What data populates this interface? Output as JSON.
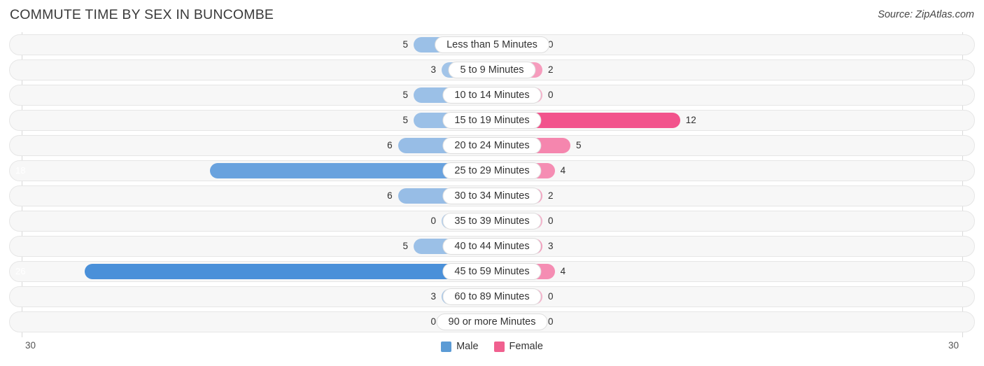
{
  "header": {
    "title": "COMMUTE TIME BY SEX IN BUNCOMBE",
    "source": "Source: ZipAtlas.com"
  },
  "legend": {
    "male_label": "Male",
    "female_label": "Female",
    "male_color": "#5b9bd5",
    "female_color": "#f0608f"
  },
  "axis": {
    "left_tick": "30",
    "right_tick": "30",
    "max": 30
  },
  "chart_data": {
    "type": "bar",
    "title": "COMMUTE TIME BY SEX IN BUNCOMBE",
    "subtitle": "Source: ZipAtlas.com",
    "orientation": "horizontal-diverging",
    "xlabel": "",
    "ylabel": "",
    "xlim": [
      30,
      30
    ],
    "grid": false,
    "legend_position": "bottom-center",
    "categories": [
      "Less than 5 Minutes",
      "5 to 9 Minutes",
      "10 to 14 Minutes",
      "15 to 19 Minutes",
      "20 to 24 Minutes",
      "25 to 29 Minutes",
      "30 to 34 Minutes",
      "35 to 39 Minutes",
      "40 to 44 Minutes",
      "45 to 59 Minutes",
      "60 to 89 Minutes",
      "90 or more Minutes"
    ],
    "series": [
      {
        "name": "Male",
        "values": [
          5,
          3,
          5,
          5,
          6,
          18,
          6,
          0,
          5,
          26,
          3,
          0
        ]
      },
      {
        "name": "Female",
        "values": [
          0,
          2,
          0,
          12,
          5,
          4,
          2,
          0,
          3,
          4,
          0,
          0
        ]
      }
    ]
  },
  "rows": [
    {
      "label": "Less than 5 Minutes",
      "male": "5",
      "female": "0"
    },
    {
      "label": "5 to 9 Minutes",
      "male": "3",
      "female": "2"
    },
    {
      "label": "10 to 14 Minutes",
      "male": "5",
      "female": "0"
    },
    {
      "label": "15 to 19 Minutes",
      "male": "5",
      "female": "12"
    },
    {
      "label": "20 to 24 Minutes",
      "male": "6",
      "female": "5"
    },
    {
      "label": "25 to 29 Minutes",
      "male": "18",
      "female": "4"
    },
    {
      "label": "30 to 34 Minutes",
      "male": "6",
      "female": "2"
    },
    {
      "label": "35 to 39 Minutes",
      "male": "0",
      "female": "0"
    },
    {
      "label": "40 to 44 Minutes",
      "male": "5",
      "female": "3"
    },
    {
      "label": "45 to 59 Minutes",
      "male": "26",
      "female": "4"
    },
    {
      "label": "60 to 89 Minutes",
      "male": "3",
      "female": "0"
    },
    {
      "label": "90 or more Minutes",
      "male": "0",
      "female": "0"
    }
  ]
}
